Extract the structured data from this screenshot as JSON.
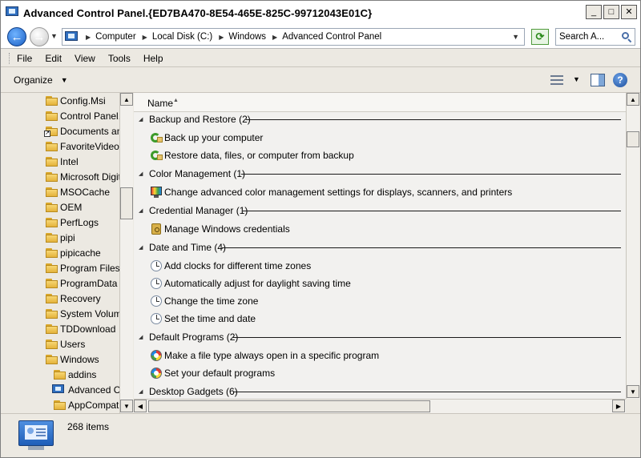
{
  "window": {
    "title": "Advanced Control Panel.{ED7BA470-8E54-465E-825C-99712043E01C}",
    "controls": [
      "_",
      "□",
      "✕"
    ]
  },
  "address": {
    "breadcrumbs": [
      "Computer",
      "Local Disk (C:)",
      "Windows",
      "Advanced Control Panel"
    ],
    "search_placeholder": "Search A..."
  },
  "menu": [
    "File",
    "Edit",
    "View",
    "Tools",
    "Help"
  ],
  "command_bar": {
    "organize_label": "Organize"
  },
  "nav": {
    "items": [
      {
        "label": "Config.Msi",
        "icon": "folder-icon"
      },
      {
        "label": "Control Panel.{",
        "icon": "folder-icon"
      },
      {
        "label": "Documents and",
        "icon": "folder-shortcut-icon"
      },
      {
        "label": "FavoriteVideo",
        "icon": "folder-icon"
      },
      {
        "label": "Intel",
        "icon": "folder-icon"
      },
      {
        "label": "Microsoft Digita",
        "icon": "folder-icon"
      },
      {
        "label": "MSOCache",
        "icon": "folder-icon"
      },
      {
        "label": "OEM",
        "icon": "folder-icon"
      },
      {
        "label": "PerfLogs",
        "icon": "folder-icon"
      },
      {
        "label": "pipi",
        "icon": "folder-icon"
      },
      {
        "label": "pipicache",
        "icon": "folder-icon"
      },
      {
        "label": "Program Files",
        "icon": "folder-icon"
      },
      {
        "label": "ProgramData",
        "icon": "folder-icon"
      },
      {
        "label": "Recovery",
        "icon": "folder-icon"
      },
      {
        "label": "System Volume",
        "icon": "folder-icon"
      },
      {
        "label": "TDDownload",
        "icon": "folder-icon"
      },
      {
        "label": "Users",
        "icon": "folder-icon"
      },
      {
        "label": "Windows",
        "icon": "folder-icon"
      },
      {
        "label": "addins",
        "icon": "folder-icon"
      },
      {
        "label": "Advanced Co",
        "icon": "control-panel-icon"
      },
      {
        "label": "AppCompat",
        "icon": "folder-icon"
      }
    ]
  },
  "content": {
    "column_header": "Name",
    "groups": [
      {
        "label": "Backup and Restore (2)",
        "icon": "backup-icon",
        "items": [
          "Back up your computer",
          "Restore data, files, or computer from backup"
        ]
      },
      {
        "label": "Color Management (1)",
        "icon": "color-management-icon",
        "items": [
          "Change advanced color management settings for displays, scanners, and printers"
        ]
      },
      {
        "label": "Credential Manager (1)",
        "icon": "credential-manager-icon",
        "items": [
          "Manage Windows credentials"
        ]
      },
      {
        "label": "Date and Time (4)",
        "icon": "clock-icon",
        "items": [
          "Add clocks for different time zones",
          "Automatically adjust for daylight saving time",
          "Change the time zone",
          "Set the time and date"
        ]
      },
      {
        "label": "Default Programs (2)",
        "icon": "default-programs-icon",
        "items": [
          "Make a file type always open in a specific program",
          "Set your default programs"
        ]
      },
      {
        "label": "Desktop Gadgets (6)",
        "icon": "gadgets-icon",
        "items": []
      }
    ]
  },
  "details": {
    "item_count": "268 items"
  }
}
